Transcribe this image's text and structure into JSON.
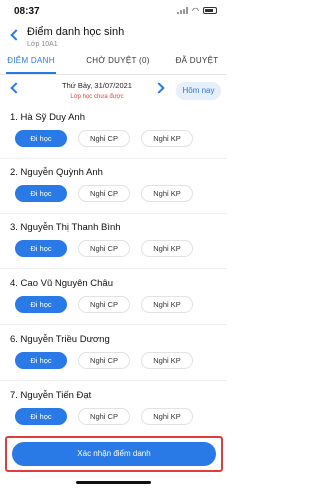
{
  "status_bar": {
    "time": "08:37"
  },
  "header": {
    "title": "Điểm danh học sinh",
    "subtitle": "Lớp 10A1"
  },
  "tabs": [
    {
      "label": "ĐIỂM DANH",
      "active": true
    },
    {
      "label": "CHỜ DUYỆT (0)",
      "active": false
    },
    {
      "label": "ĐÃ DUYỆT",
      "active": false
    }
  ],
  "date_bar": {
    "date": "Thứ Bảy, 31/07/2021",
    "status": "Lớp học chưa được",
    "today_label": "Hôm nay"
  },
  "attendance_options": [
    "Đi học",
    "Nghỉ CP",
    "Nghỉ KP"
  ],
  "students": [
    {
      "name": "1. Hà Sỹ Duy Anh",
      "selected": "Đi học"
    },
    {
      "name": "2. Nguyễn Quỳnh Anh",
      "selected": "Đi học"
    },
    {
      "name": "3. Nguyễn Thị Thanh Bình",
      "selected": "Đi học"
    },
    {
      "name": "4. Cao Vũ Nguyên Châu",
      "selected": "Đi học"
    },
    {
      "name": "6. Nguyễn Triều Dương",
      "selected": "Đi học"
    },
    {
      "name": "7. Nguyễn Tiến Đạt",
      "selected": "Đi học"
    }
  ],
  "footer": {
    "confirm_label": "Xác nhận điểm danh"
  },
  "colors": {
    "accent": "#2979e6",
    "highlight_outline": "#e23b3b",
    "status_text": "#e0443a"
  }
}
